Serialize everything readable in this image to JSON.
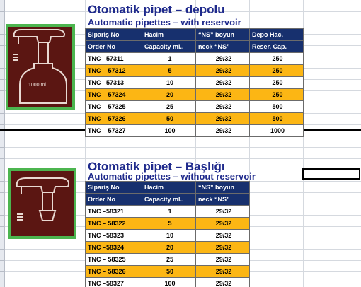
{
  "section1": {
    "title": "Otomatik pipet – depolu",
    "subtitle": "Automatic pipettes – with reservoir",
    "photo_label": "1000 ml",
    "header_row1": [
      "Sipariş No",
      "Hacim",
      "“NS” boyun",
      "Depo Hac."
    ],
    "header_row2": [
      "Order No",
      "Capacity ml..",
      "neck “NS”",
      "Reser. Cap."
    ],
    "rows": [
      {
        "code": "TNC –57311",
        "capacity": "1",
        "neck": "29/32",
        "reservoir": "250",
        "highlight": false
      },
      {
        "code": "TNC – 57312",
        "capacity": "5",
        "neck": "29/32",
        "reservoir": "250",
        "highlight": true
      },
      {
        "code": "TNC –57313",
        "capacity": "10",
        "neck": "29/32",
        "reservoir": "250",
        "highlight": false
      },
      {
        "code": "TNC – 57324",
        "capacity": "20",
        "neck": "29/32",
        "reservoir": "250",
        "highlight": true
      },
      {
        "code": "TNC – 57325",
        "capacity": "25",
        "neck": "29/32",
        "reservoir": "500",
        "highlight": false
      },
      {
        "code": "TNC – 57326",
        "capacity": "50",
        "neck": "29/32",
        "reservoir": "500",
        "highlight": true
      },
      {
        "code": "TNC – 57327",
        "capacity": "100",
        "neck": "29/32",
        "reservoir": "1000",
        "highlight": false
      }
    ]
  },
  "section2": {
    "title": "Otomatik pipet – Başlığı",
    "subtitle": "Automatic pipettes – without reservoir",
    "header_row1": [
      "Sipariş No",
      "Hacim",
      "“NS” boyun"
    ],
    "header_row2": [
      "Order No",
      "Capacity ml..",
      "neck “NS”"
    ],
    "rows": [
      {
        "code": "TNC –58321",
        "capacity": "1",
        "neck": "29/32",
        "highlight": false
      },
      {
        "code": "TNC – 58322",
        "capacity": "5",
        "neck": "29/32",
        "highlight": true
      },
      {
        "code": "TNC –58323",
        "capacity": "10",
        "neck": "29/32",
        "highlight": false
      },
      {
        "code": "TNC –58324",
        "capacity": "20",
        "neck": "29/32",
        "highlight": true
      },
      {
        "code": "TNC – 58325",
        "capacity": "25",
        "neck": "29/32",
        "highlight": false
      },
      {
        "code": "TNC – 58326",
        "capacity": "50",
        "neck": "29/32",
        "highlight": true
      },
      {
        "code": "TNC –58327",
        "capacity": "100",
        "neck": "29/32",
        "highlight": false
      }
    ]
  },
  "colors": {
    "header_bg": "#17306e",
    "highlight_row": "#fcb614",
    "title_text": "#1f2a8c",
    "photo_border": "#4cb54f",
    "photo_bg": "#5b1612"
  }
}
